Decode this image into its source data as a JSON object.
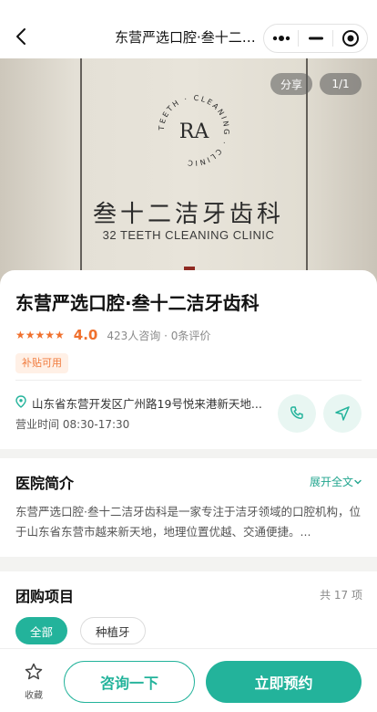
{
  "navbar": {
    "title": "东营严选口腔·叁十二洁牙齿科",
    "back_icon": "chevron-left-icon",
    "more_icon": "more-dots-icon",
    "minimize_icon": "minus-icon",
    "close_icon": "target-circle-icon"
  },
  "hero": {
    "logo_mark": "RA",
    "logo_ring_text": "TEETH · CLEANING · CLINIC",
    "clinic_name_cn": "叁十二洁牙齿科",
    "clinic_name_en": "32 TEETH CLEANING CLINIC",
    "share_label": "分享",
    "image_counter": "1/1"
  },
  "clinic": {
    "name": "东营严选口腔·叁十二洁牙齿科",
    "stars": "★★★★★",
    "score": "4.0",
    "meta": "423人咨询 · 0条评价",
    "tag": "补贴可用",
    "address": "山东省东营开发区广州路19号悦来港新天地...",
    "hours": "营业时间 08:30-17:30"
  },
  "intro": {
    "title": "医院简介",
    "expand_label": "展开全文",
    "text": "东营严选口腔·叁十二洁牙齿科是一家专注于洁牙领域的口腔机构，位于山东省东营市越来新天地，地理位置优越、交通便捷。..."
  },
  "group": {
    "title": "团购项目",
    "count": "共 17 项",
    "chips": [
      "全部",
      "种植牙"
    ]
  },
  "bottom": {
    "favorite_label": "收藏",
    "consult_label": "咨询一下",
    "book_label": "立即预约"
  },
  "colors": {
    "accent": "#23b39b",
    "rating": "#f0702d",
    "tag_bg": "#fff0e6"
  }
}
